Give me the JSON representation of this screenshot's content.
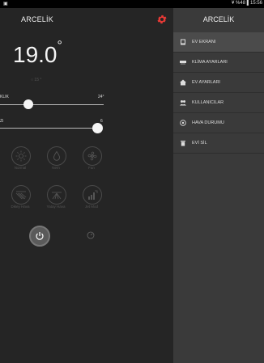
{
  "status_bar": {
    "left_icon": "image-icon",
    "right_text": "¥ %48 ▌15:56"
  },
  "header": {
    "title": "ARCELİK",
    "settings_icon": "gear-icon",
    "accent_color": "#e53935"
  },
  "temperature": {
    "value": "19.0",
    "unit": "°",
    "sub": "○ 15 °"
  },
  "sliders": [
    {
      "label_left": "KLIK",
      "label_right": "24°",
      "level": 0.27
    },
    {
      "label_left": "Zi",
      "label_right": "6",
      "level": 1.0
    }
  ],
  "modes": [
    {
      "label": "Normal",
      "icon": "sun-icon"
    },
    {
      "label": "Nem",
      "icon": "drop-icon"
    },
    {
      "label": "Fan",
      "icon": "fan-icon"
    },
    {
      "label": "Dikey Hava",
      "icon": "vertical-swing-icon"
    },
    {
      "label": "Yatay Hava",
      "icon": "horizontal-swing-icon"
    },
    {
      "label": "Jet Mod",
      "icon": "jet-icon"
    }
  ],
  "drawer": {
    "title": "ARCELİK",
    "items": [
      {
        "label": "EV EKRANI",
        "icon": "home-screen-icon",
        "active": true
      },
      {
        "label": "KLİMA AYARLARI",
        "icon": "aircon-icon",
        "active": false
      },
      {
        "label": "EV AYARLARI",
        "icon": "house-icon",
        "active": false
      },
      {
        "label": "KULLANICILAR",
        "icon": "users-icon",
        "active": false
      },
      {
        "label": "HAVA DURUMU",
        "icon": "weather-icon",
        "active": false
      },
      {
        "label": "EVİ SİL",
        "icon": "trash-icon",
        "active": false
      }
    ]
  }
}
